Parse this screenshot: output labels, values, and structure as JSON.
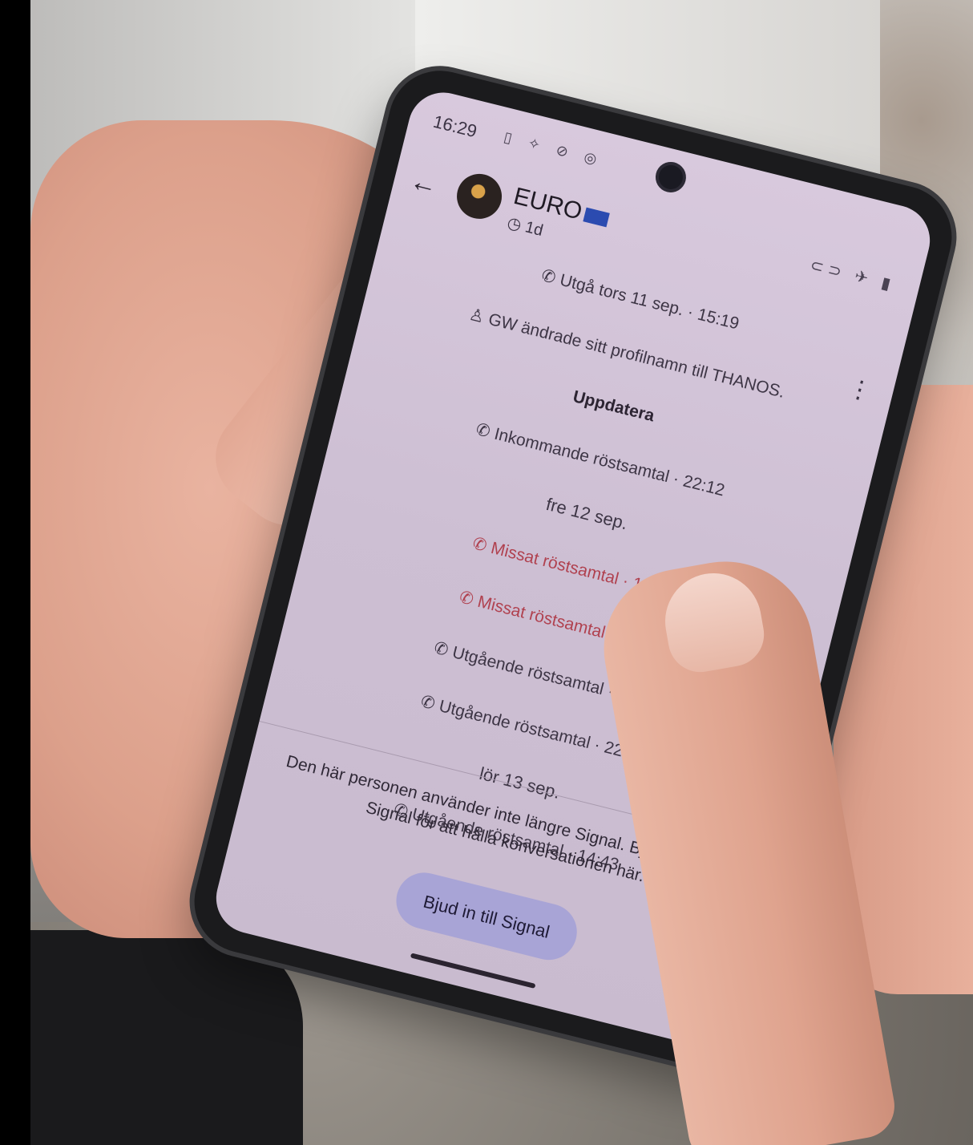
{
  "statusbar": {
    "time": "16:29",
    "icons": "▯ ✧ ⊘ ◎",
    "right_icons": "⊂⊃ ✈ ▮"
  },
  "header": {
    "back_icon": "←",
    "contact_name": "EURO",
    "disappearing_timer": "1d",
    "timer_icon": "◷",
    "more_icon": "⋮"
  },
  "messages": [
    {
      "text": "Utgå  tors 11 sep. · 15:19",
      "kind": "call",
      "icon": "phone-icon"
    },
    {
      "text": "GW ändrade sitt profilnamn till THANOS.",
      "kind": "profile",
      "icon": "person-icon"
    },
    {
      "text": "Uppdatera",
      "kind": "action"
    },
    {
      "text": "Inkommande röstsamtal · 22:12",
      "kind": "call",
      "icon": "phone-icon"
    },
    {
      "text": "fre 12 sep.",
      "kind": "date"
    },
    {
      "text": "Missat röstsamtal · 16:27",
      "kind": "missed",
      "icon": "phone-icon"
    },
    {
      "text": "Missat röstsamtal · 16:33",
      "kind": "missed",
      "icon": "phone-icon"
    },
    {
      "text": "Utgående röstsamtal · 16:36",
      "kind": "call",
      "icon": "phone-icon"
    },
    {
      "text": "Utgående röstsamtal · 22:32",
      "kind": "call",
      "icon": "phone-icon"
    },
    {
      "text": "lör 13 sep.",
      "kind": "date"
    },
    {
      "text": "Utgående röstsamtal · 14:43",
      "kind": "call",
      "icon": "phone-icon"
    }
  ],
  "footer": {
    "notice": "Den här personen använder inte längre Signal. Bjud in dem till Signal för att hålla konversationen här.",
    "invite_button": "Bjud in till Signal",
    "scroll_down_icon": "⌄"
  },
  "colors": {
    "screen_bg": "#d2c4d8",
    "missed_call": "#b0414f",
    "invite_button_bg": "#a8a4d6"
  }
}
